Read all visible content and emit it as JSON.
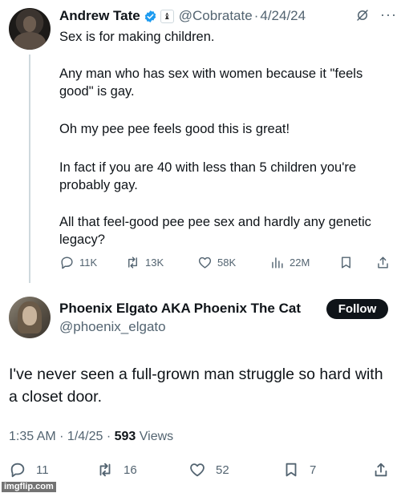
{
  "parent_tweet": {
    "author_name": "Andrew Tate",
    "handle": "@Cobratate",
    "separator": "·",
    "date": "4/24/24",
    "paragraphs": [
      "Sex is for making children.",
      "Any man who has sex with women because it \"feels good\" is gay.",
      "Oh my pee pee feels good this is great!",
      "In fact if you are 40 with less than 5 children you're probably gay.",
      "All that feel-good pee pee sex and hardly any genetic legacy?"
    ],
    "stats": {
      "replies": "11K",
      "reposts": "13K",
      "likes": "58K",
      "views": "22M"
    },
    "icons": [
      "verified-badge-icon",
      "affiliate-badge-icon",
      "grok-icon",
      "more-icon",
      "reply-icon",
      "repost-icon",
      "like-icon",
      "views-icon",
      "bookmark-icon",
      "share-icon"
    ]
  },
  "reply_tweet": {
    "author_name": "Phoenix Elgato AKA Phoenix The Cat",
    "handle": "@phoenix_elgato",
    "follow_label": "Follow",
    "text": "I've never seen a full-grown man struggle so hard with a closet door.",
    "time_date": "1:35 AM · 1/4/25 · ",
    "views_count": "593",
    "views_label": " Views",
    "stats": {
      "replies": "11",
      "reposts": "16",
      "likes": "52",
      "bookmarks": "7"
    }
  },
  "watermark": "imgflip.com",
  "colors": {
    "text": "#0f1419",
    "secondary": "#536471",
    "verified_blue": "#1d9bf0",
    "thread_line": "#cfd9de",
    "follow_button": "#0f1419"
  }
}
